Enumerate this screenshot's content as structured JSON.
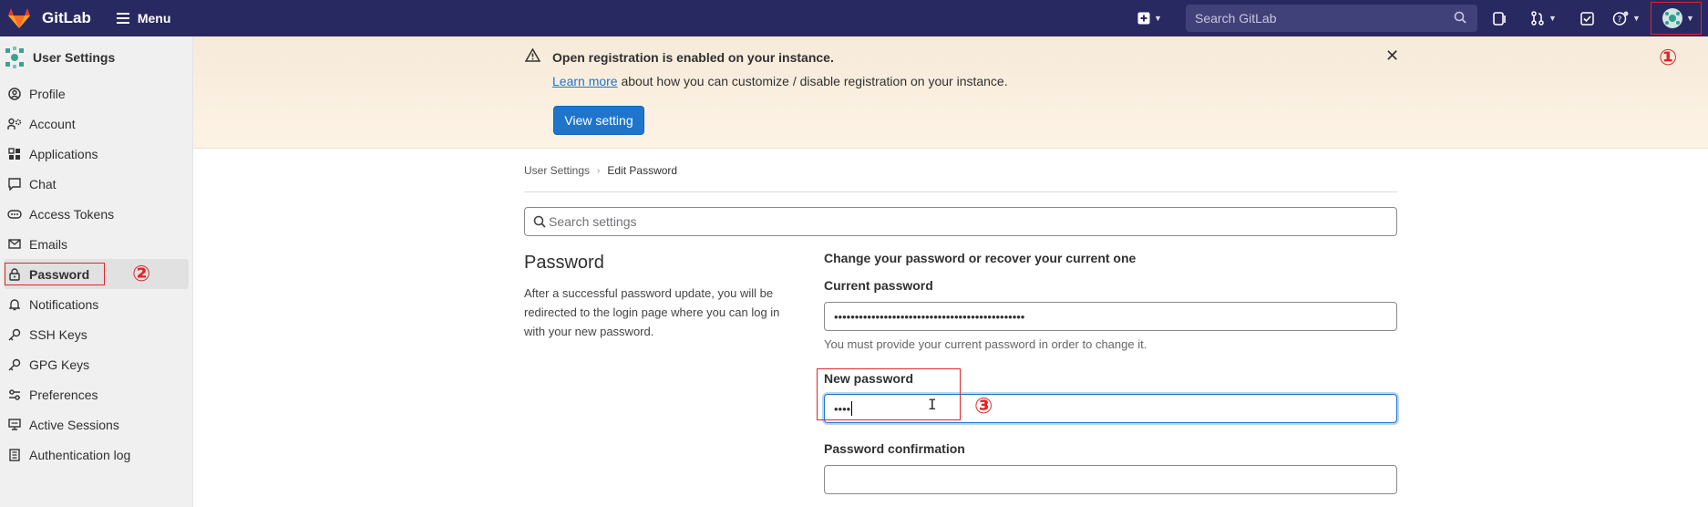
{
  "topbar": {
    "brand_name": "GitLab",
    "menu_label": "Menu",
    "search_placeholder": "Search GitLab"
  },
  "sidebar": {
    "title": "User Settings",
    "items": [
      {
        "label": "Profile",
        "icon": "profile-icon"
      },
      {
        "label": "Account",
        "icon": "account-icon"
      },
      {
        "label": "Applications",
        "icon": "applications-icon"
      },
      {
        "label": "Chat",
        "icon": "chat-icon"
      },
      {
        "label": "Access Tokens",
        "icon": "token-icon"
      },
      {
        "label": "Emails",
        "icon": "mail-icon"
      },
      {
        "label": "Password",
        "icon": "lock-icon",
        "active": true
      },
      {
        "label": "Notifications",
        "icon": "bell-icon"
      },
      {
        "label": "SSH Keys",
        "icon": "key-icon"
      },
      {
        "label": "GPG Keys",
        "icon": "key-icon"
      },
      {
        "label": "Preferences",
        "icon": "preferences-icon"
      },
      {
        "label": "Active Sessions",
        "icon": "monitor-icon"
      },
      {
        "label": "Authentication log",
        "icon": "log-icon"
      }
    ]
  },
  "banner": {
    "title": "Open registration is enabled on your instance.",
    "link_text": "Learn more",
    "body_text": " about how you can customize / disable registration on your instance.",
    "button_label": "View setting"
  },
  "breadcrumb": {
    "parent": "User Settings",
    "current": "Edit Password"
  },
  "settings_search": {
    "placeholder": "Search settings"
  },
  "password_section": {
    "title": "Password",
    "description": "After a successful password update, you will be redirected to the login page where you can log in with your new password.",
    "form_heading": "Change your password or recover your current one",
    "current_label": "Current password",
    "current_value": "••••••••••••••••••••••••••••••••••••••••••••••",
    "current_help": "You must provide your current password in order to change it.",
    "new_label": "New password",
    "new_value": "••••",
    "confirm_label": "Password confirmation",
    "confirm_value": ""
  },
  "annotations": {
    "one": "①",
    "two": "②",
    "three": "③",
    "color": "#e0242a"
  },
  "colors": {
    "topbar": "#292961",
    "primary": "#1f75cb",
    "sidebar_bg": "#f0f0f0",
    "banner_bg": "#fdf3e5"
  }
}
